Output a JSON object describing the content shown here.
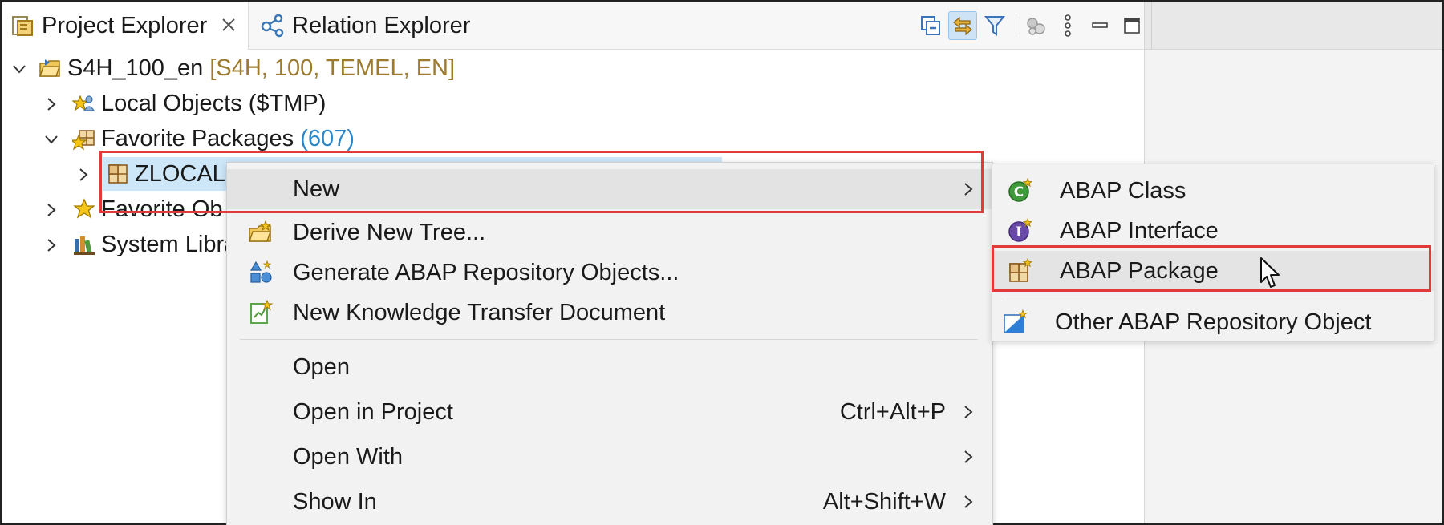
{
  "tabs": {
    "project_explorer": "Project Explorer",
    "relation_explorer": "Relation Explorer"
  },
  "toolbar": {
    "icons": [
      "collapse-all-icon",
      "link-with-editor-icon",
      "filter-icon",
      "settings-icon",
      "view-menu-icon",
      "minimize-icon",
      "maximize-icon"
    ]
  },
  "tree": {
    "project": {
      "name": "S4H_100_en",
      "decoration": "[S4H, 100, TEMEL, EN]"
    },
    "local_objects": "Local Objects ($TMP)",
    "favorite_packages": {
      "label": "Favorite Packages",
      "count": "(607)"
    },
    "zlocal": "ZLOCAL",
    "favorite_objects": "Favorite Ob",
    "system_library": "System Libra"
  },
  "context_menu": {
    "items": [
      {
        "label": "New",
        "shortcut": ""
      },
      {
        "label": "Derive New Tree...",
        "shortcut": ""
      },
      {
        "label": "Generate ABAP Repository Objects...",
        "shortcut": ""
      },
      {
        "label": "New Knowledge Transfer Document",
        "shortcut": ""
      },
      {
        "label": "Open",
        "shortcut": ""
      },
      {
        "label": "Open in Project",
        "shortcut": "Ctrl+Alt+P"
      },
      {
        "label": "Open With",
        "shortcut": ""
      },
      {
        "label": "Show In",
        "shortcut": "Alt+Shift+W"
      }
    ]
  },
  "submenu": {
    "items": [
      {
        "label": "ABAP Class"
      },
      {
        "label": "ABAP Interface"
      },
      {
        "label": "ABAP Package"
      },
      {
        "label": "Other ABAP Repository Object"
      }
    ]
  },
  "colors": {
    "highlight": "#e03a3a",
    "selection": "#cde6f8",
    "decoration": "#9c7a2e",
    "count": "#2a86c8"
  }
}
